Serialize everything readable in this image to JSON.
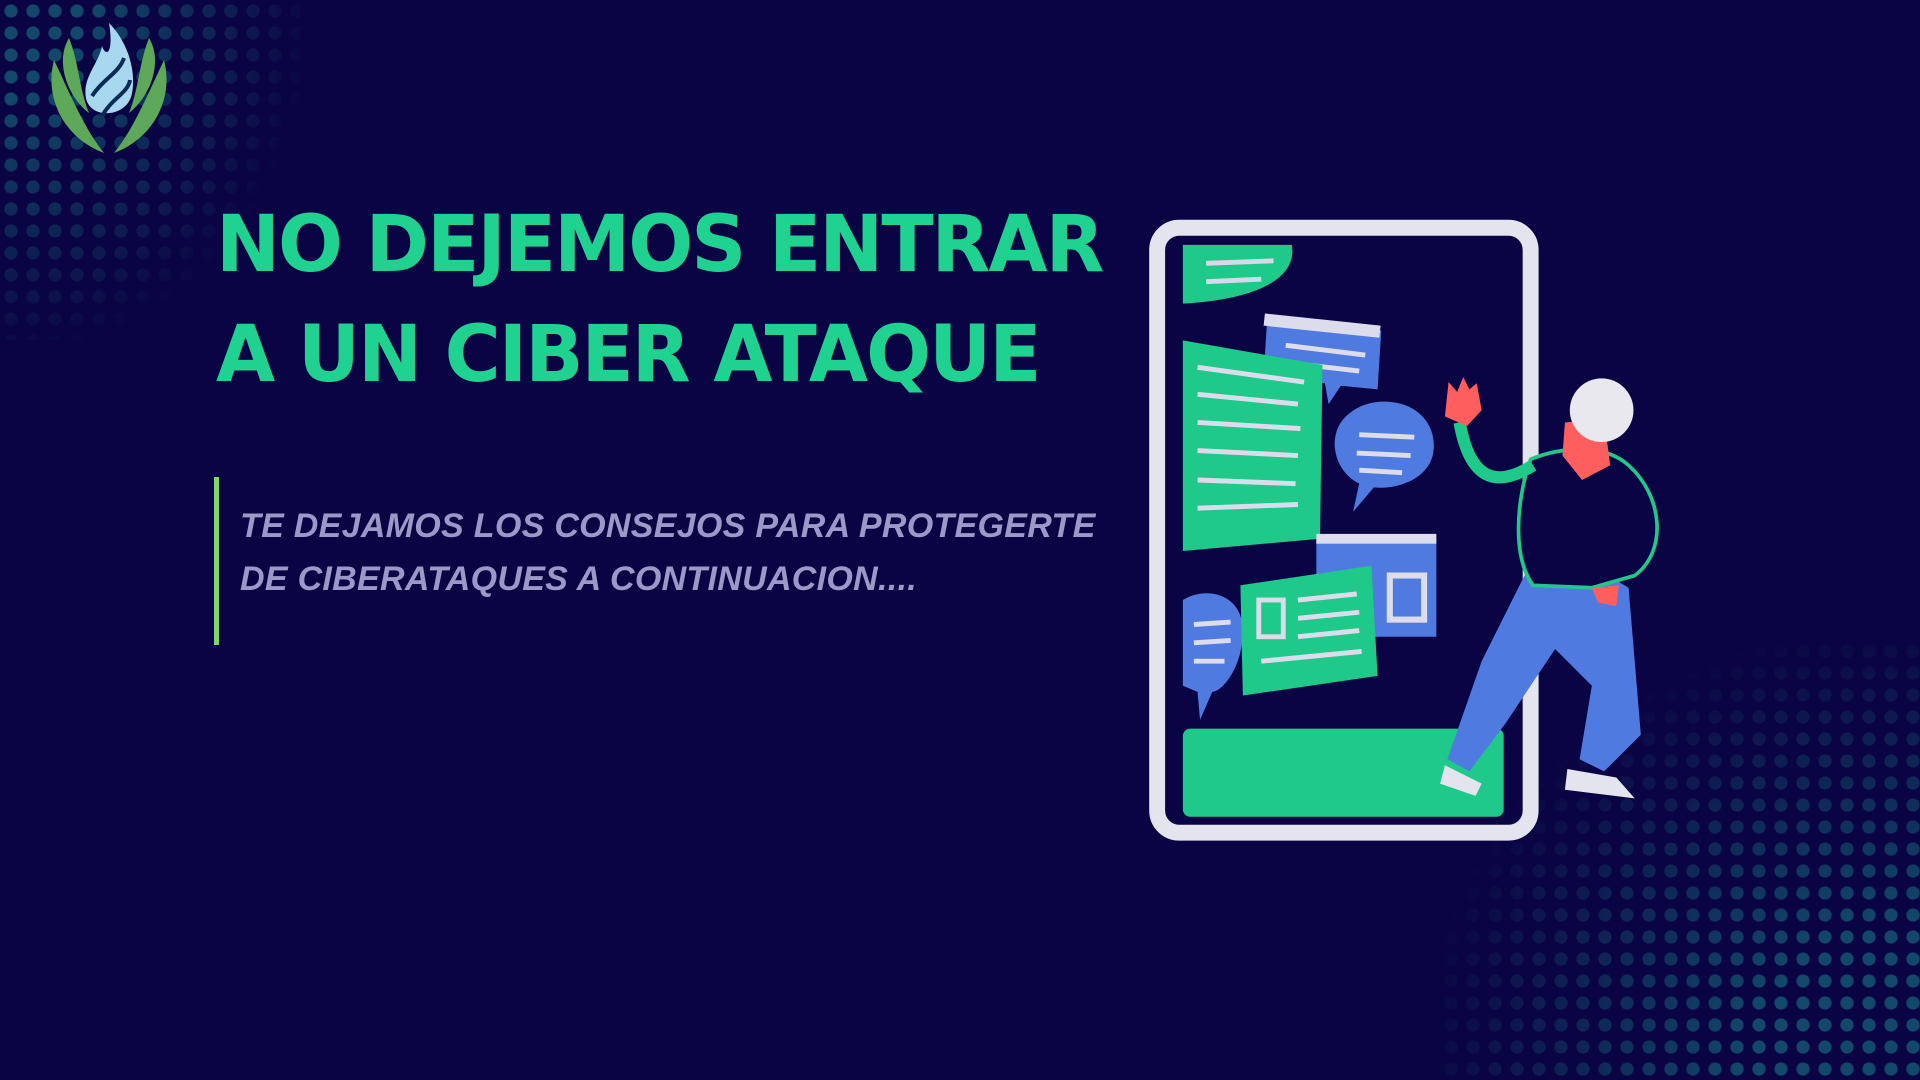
{
  "title": {
    "line1": "NO DEJEMOS ENTRAR",
    "line2": "A UN CIBER ATAQUE"
  },
  "subtitle": {
    "line1": "TE DEJAMOS LOS CONSEJOS PARA PROTEGERTE",
    "line2": "DE CIBERATAQUES A CONTINUACION...."
  },
  "colors": {
    "background": "#0b0444",
    "title": "#1fd28f",
    "subtitle": "#9c99c9",
    "accent_bar": "#7fd46c",
    "halftone": "#12496a"
  },
  "illustration": {
    "icon": "phone-chat-person-illustration"
  },
  "logo": {
    "icon": "flame-leaves-logo"
  }
}
